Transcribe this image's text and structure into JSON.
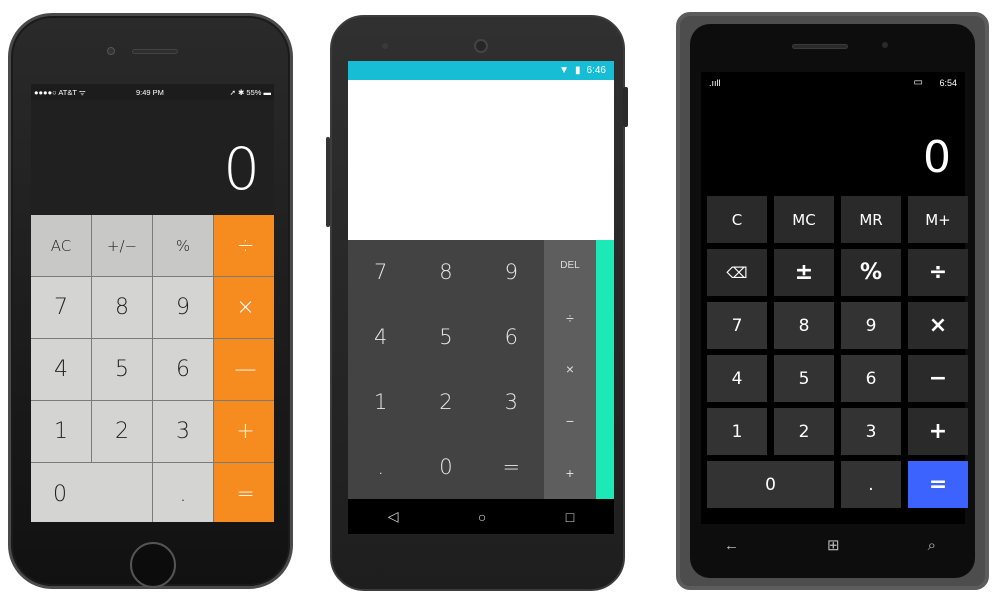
{
  "ios": {
    "status": {
      "carrier": "●●●●○ AT&T ᯤ",
      "time": "9:49 PM",
      "battery": "➚ ✱ 55% ▬"
    },
    "display": "0",
    "keys": [
      "AC",
      "+/−",
      "%",
      "÷",
      "7",
      "8",
      "9",
      "×",
      "4",
      "5",
      "6",
      "—",
      "1",
      "2",
      "3",
      "+",
      "0",
      ".",
      "="
    ]
  },
  "android": {
    "status": {
      "time": "6:46"
    },
    "pad": [
      "7",
      "8",
      "9",
      "4",
      "5",
      "6",
      "1",
      "2",
      "3",
      ".",
      "0",
      "="
    ],
    "ops": [
      "DEL",
      "÷",
      "×",
      "−",
      "+"
    ],
    "nav": {
      "back": "◁",
      "home": "○",
      "recents": "□"
    }
  },
  "windows": {
    "status": {
      "signal": ".ııll",
      "time": "6:54"
    },
    "display": "0",
    "keys": [
      "C",
      "MC",
      "MR",
      "M+",
      "⌫",
      "±",
      "%",
      "÷",
      "7",
      "8",
      "9",
      "×",
      "4",
      "5",
      "6",
      "−",
      "1",
      "2",
      "3",
      "+",
      "0",
      ".",
      "="
    ],
    "hw": {
      "back": "←",
      "start": "⊞",
      "search": "⌕"
    }
  },
  "colors": {
    "ios_operator": "#f68c1f",
    "android_accent": "#16bdd5",
    "android_drawer": "#1de9b6",
    "wp_equals": "#3d63ff"
  }
}
